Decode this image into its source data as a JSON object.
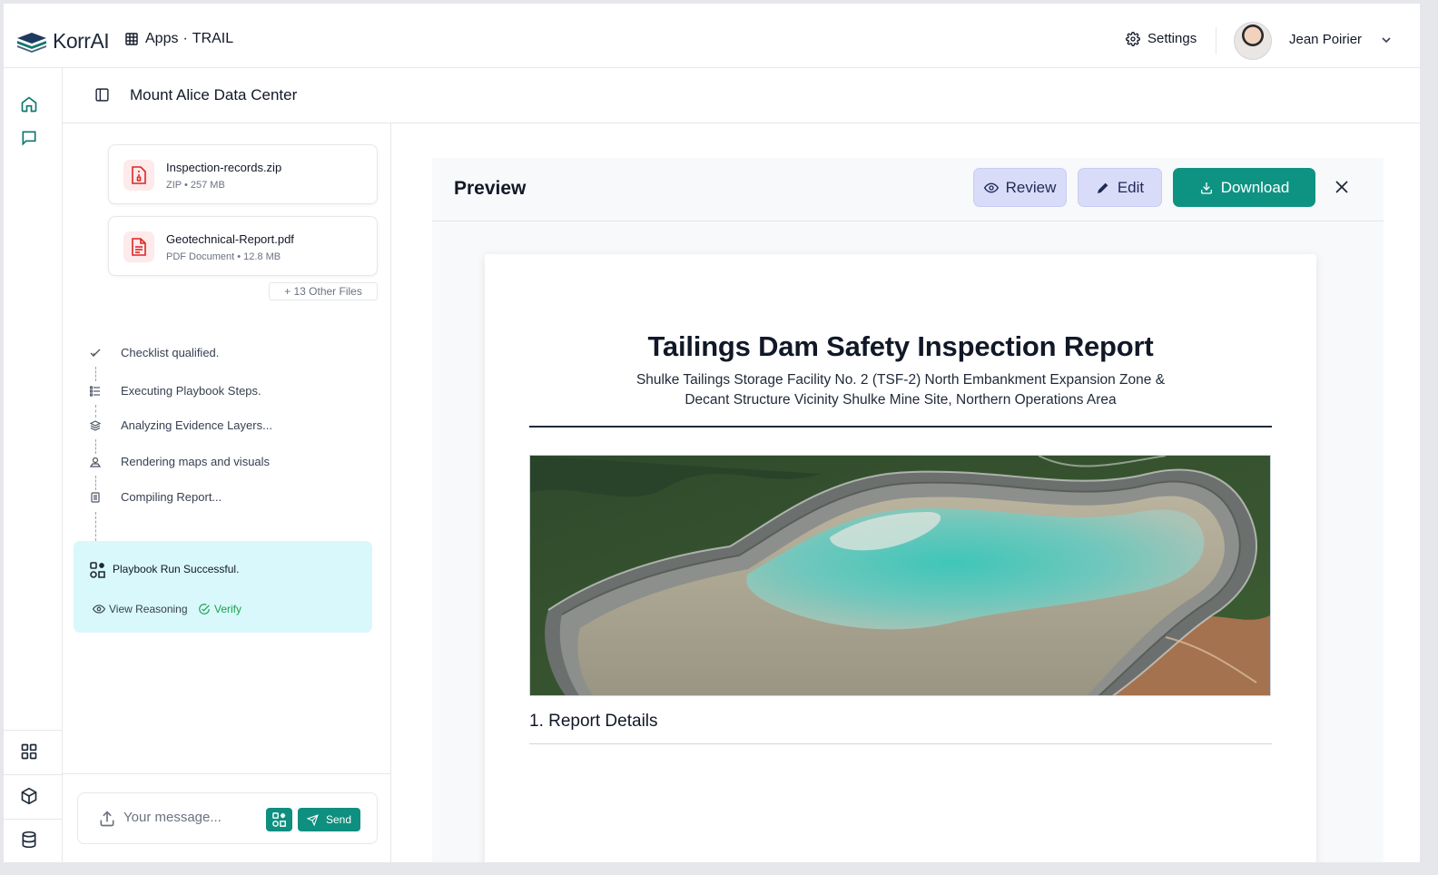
{
  "app": {
    "brand": "KorrAI",
    "apps_label": "Apps",
    "apps_context": "TRAIL",
    "settings_label": "Settings",
    "user_name": "Jean Poirier"
  },
  "header": {
    "title": "Mount Alice Data Center"
  },
  "files": [
    {
      "name": "Inspection-records.zip",
      "meta": "ZIP • 257 MB"
    },
    {
      "name": "Geotechnical-Report.pdf",
      "meta": "PDF Document • 12.8 MB"
    }
  ],
  "other_files_label": "+ 13 Other Files",
  "steps": [
    {
      "label": "Checklist qualified.",
      "icon": "check-icon"
    },
    {
      "label": "Executing Playbook Steps.",
      "icon": "list-icon"
    },
    {
      "label": "Analyzing Evidence Layers...",
      "icon": "layers-icon"
    },
    {
      "label": "Rendering maps and visuals",
      "icon": "map-pin-icon"
    },
    {
      "label": "Compiling Report...",
      "icon": "document-icon"
    }
  ],
  "result": {
    "title": "Playbook Run Successful.",
    "view_reasoning": "View Reasoning",
    "verify": "Verify"
  },
  "composer": {
    "placeholder": "Your message...",
    "send_label": "Send"
  },
  "preview": {
    "title": "Preview",
    "review_label": "Review",
    "edit_label": "Edit",
    "download_label": "Download"
  },
  "document": {
    "title": "Tailings Dam Safety Inspection Report",
    "subtitle_line1": "Shulke Tailings Storage Facility No. 2 (TSF-2) North Embankment Expansion Zone &",
    "subtitle_line2": "Decant Structure Vicinity Shulke Mine Site, Northern Operations Area",
    "section_1": "1. Report Details"
  },
  "colors": {
    "accent": "#0e9382",
    "success_bg": "#d9f8fb",
    "secondary_btn": "#d8dcf8"
  }
}
